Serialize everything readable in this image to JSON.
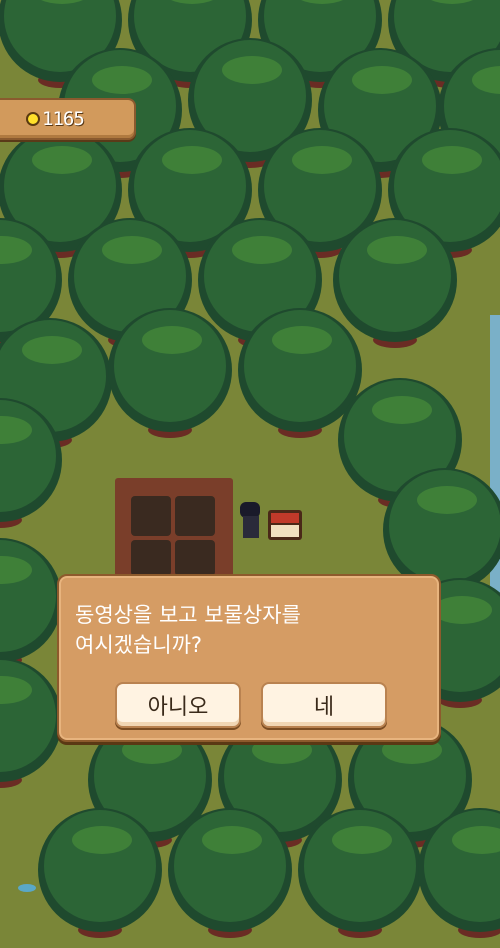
{
  "hud": {
    "coins": "1165",
    "coin_icon": "gold-coin-icon"
  },
  "dialog": {
    "message": "동영상을 보고 보물상자를 여시겠습니까?",
    "no_label": "아니오",
    "yes_label": "네"
  },
  "colors": {
    "grass": "#6e7a34",
    "tree_dark": "#1f4a2e",
    "tree_mid": "#2e6a3a",
    "tree_light": "#4a8a3c",
    "panel": "#d59c64"
  }
}
